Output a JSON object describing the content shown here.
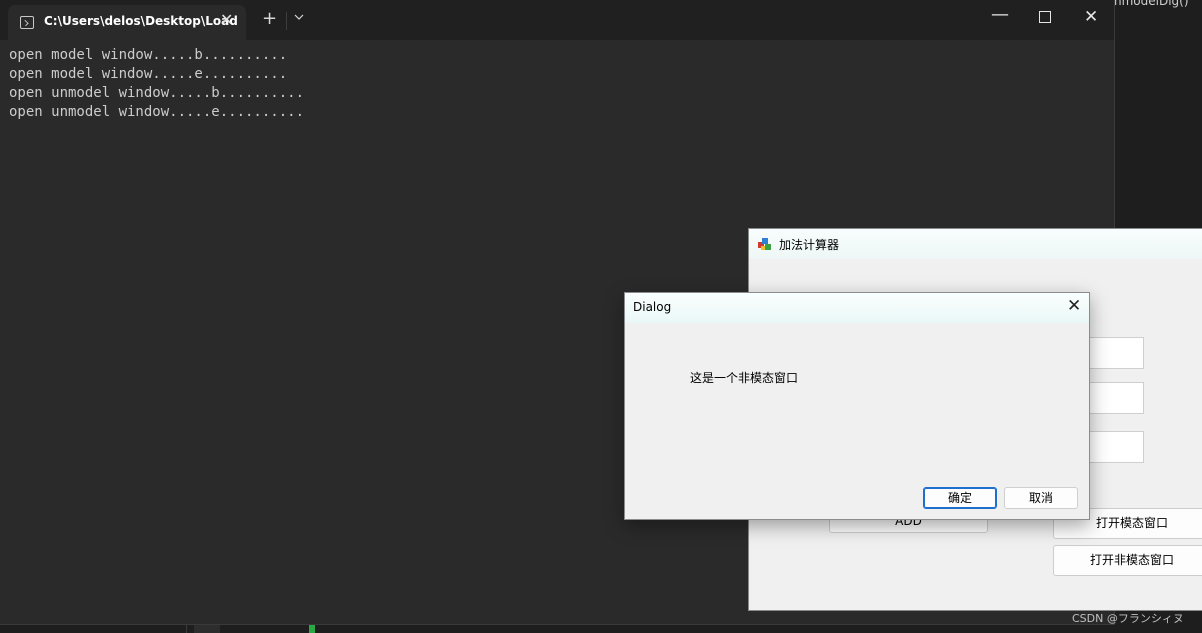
{
  "background_editor": {
    "code_fragment": "nmodelDlg()"
  },
  "terminal": {
    "tab_title": "C:\\Users\\delos\\Desktop\\Load",
    "close_glyph": "✕",
    "new_tab_glyph": "+",
    "dropdown_glyph": "⌄",
    "minimize_glyph": "—",
    "close_window_glyph": "✕",
    "lines": [
      "open model window.....b..........",
      "open model window.....e..........",
      "open unmodel window.....b..........",
      "open unmodel window.....e.........."
    ]
  },
  "calculator": {
    "title": "加法计算器",
    "add_label": "ADD",
    "open_modal_label": "打开模态窗口",
    "open_modeless_label": "打开非模态窗口"
  },
  "dialog": {
    "title": "Dialog",
    "close_glyph": "✕",
    "message": "这是一个非模态窗口",
    "ok_label": "确定",
    "cancel_label": "取消"
  },
  "watermark": "CSDN @フランシィヌ"
}
